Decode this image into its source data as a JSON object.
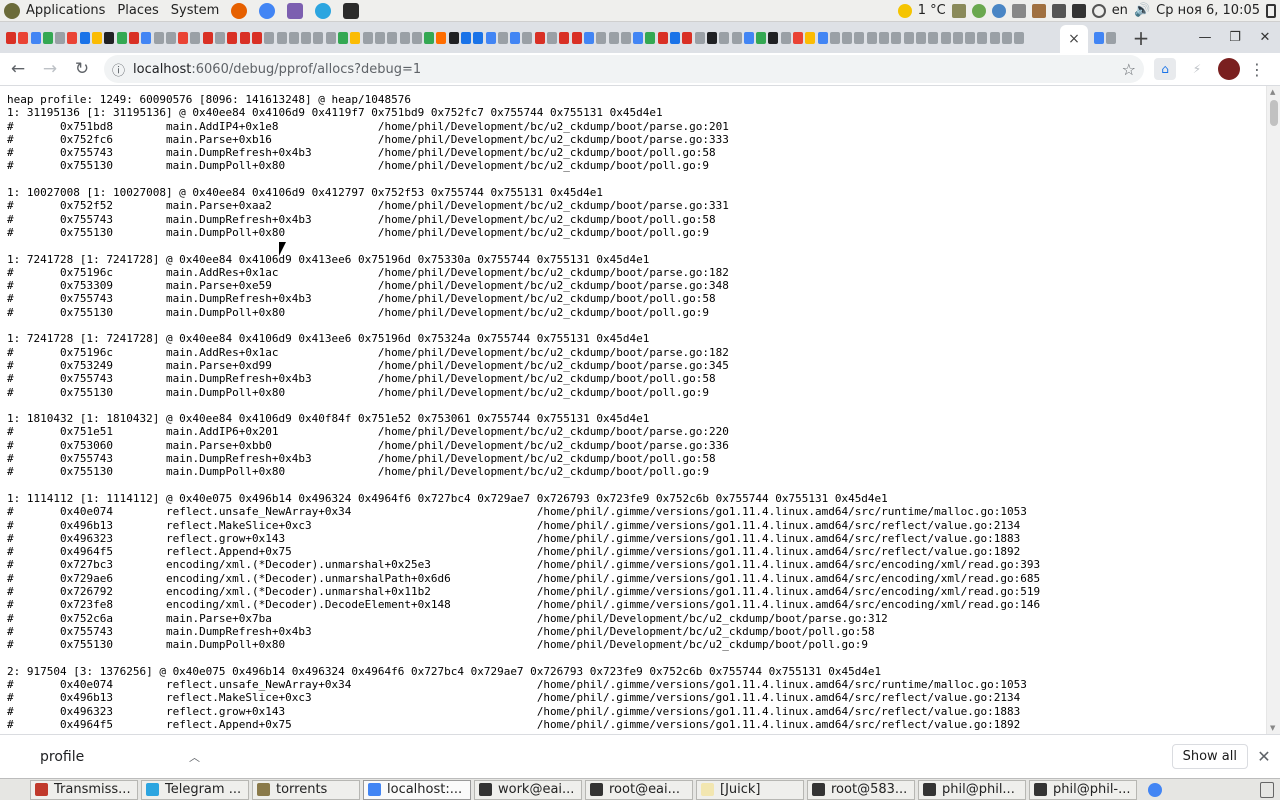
{
  "topbar": {
    "menu": [
      "Applications",
      "Places",
      "System"
    ],
    "weather": "1 °C",
    "lang": "en",
    "clock": "Ср ноя  6, 10:05"
  },
  "tabs": {
    "active_close": "×",
    "new_tab": "+"
  },
  "toolbar": {
    "url_host": "localhost",
    "url_path": ":6060/debug/pprof/allocs?debug=1"
  },
  "profile_text": "heap profile: 1249: 60090576 [8096: 141613248] @ heap/1048576\n1: 31195136 [1: 31195136] @ 0x40ee84 0x4106d9 0x4119f7 0x751bd9 0x752fc7 0x755744 0x755131 0x45d4e1\n#\t0x751bd8\tmain.AddIP4+0x1e8\t\t/home/phil/Development/bc/u2_ckdump/boot/parse.go:201\n#\t0x752fc6\tmain.Parse+0xb16\t\t/home/phil/Development/bc/u2_ckdump/boot/parse.go:333\n#\t0x755743\tmain.DumpRefresh+0x4b3\t\t/home/phil/Development/bc/u2_ckdump/boot/poll.go:58\n#\t0x755130\tmain.DumpPoll+0x80\t\t/home/phil/Development/bc/u2_ckdump/boot/poll.go:9\n\n1: 10027008 [1: 10027008] @ 0x40ee84 0x4106d9 0x412797 0x752f53 0x755744 0x755131 0x45d4e1\n#\t0x752f52\tmain.Parse+0xaa2\t\t/home/phil/Development/bc/u2_ckdump/boot/parse.go:331\n#\t0x755743\tmain.DumpRefresh+0x4b3\t\t/home/phil/Development/bc/u2_ckdump/boot/poll.go:58\n#\t0x755130\tmain.DumpPoll+0x80\t\t/home/phil/Development/bc/u2_ckdump/boot/poll.go:9\n\n1: 7241728 [1: 7241728] @ 0x40ee84 0x4106d9 0x413ee6 0x75196d 0x75330a 0x755744 0x755131 0x45d4e1\n#\t0x75196c\tmain.AddRes+0x1ac\t\t/home/phil/Development/bc/u2_ckdump/boot/parse.go:182\n#\t0x753309\tmain.Parse+0xe59\t\t/home/phil/Development/bc/u2_ckdump/boot/parse.go:348\n#\t0x755743\tmain.DumpRefresh+0x4b3\t\t/home/phil/Development/bc/u2_ckdump/boot/poll.go:58\n#\t0x755130\tmain.DumpPoll+0x80\t\t/home/phil/Development/bc/u2_ckdump/boot/poll.go:9\n\n1: 7241728 [1: 7241728] @ 0x40ee84 0x4106d9 0x413ee6 0x75196d 0x75324a 0x755744 0x755131 0x45d4e1\n#\t0x75196c\tmain.AddRes+0x1ac\t\t/home/phil/Development/bc/u2_ckdump/boot/parse.go:182\n#\t0x753249\tmain.Parse+0xd99\t\t/home/phil/Development/bc/u2_ckdump/boot/parse.go:345\n#\t0x755743\tmain.DumpRefresh+0x4b3\t\t/home/phil/Development/bc/u2_ckdump/boot/poll.go:58\n#\t0x755130\tmain.DumpPoll+0x80\t\t/home/phil/Development/bc/u2_ckdump/boot/poll.go:9\n\n1: 1810432 [1: 1810432] @ 0x40ee84 0x4106d9 0x40f84f 0x751e52 0x753061 0x755744 0x755131 0x45d4e1\n#\t0x751e51\tmain.AddIP6+0x201\t\t/home/phil/Development/bc/u2_ckdump/boot/parse.go:220\n#\t0x753060\tmain.Parse+0xbb0\t\t/home/phil/Development/bc/u2_ckdump/boot/parse.go:336\n#\t0x755743\tmain.DumpRefresh+0x4b3\t\t/home/phil/Development/bc/u2_ckdump/boot/poll.go:58\n#\t0x755130\tmain.DumpPoll+0x80\t\t/home/phil/Development/bc/u2_ckdump/boot/poll.go:9\n\n1: 1114112 [1: 1114112] @ 0x40e075 0x496b14 0x496324 0x4964f6 0x727bc4 0x729ae7 0x726793 0x723fe9 0x752c6b 0x755744 0x755131 0x45d4e1\n#\t0x40e074\treflect.unsafe_NewArray+0x34\t\t\t\t/home/phil/.gimme/versions/go1.11.4.linux.amd64/src/runtime/malloc.go:1053\n#\t0x496b13\treflect.MakeSlice+0xc3\t\t\t\t\t/home/phil/.gimme/versions/go1.11.4.linux.amd64/src/reflect/value.go:2134\n#\t0x496323\treflect.grow+0x143\t\t\t\t\t/home/phil/.gimme/versions/go1.11.4.linux.amd64/src/reflect/value.go:1883\n#\t0x4964f5\treflect.Append+0x75\t\t\t\t\t/home/phil/.gimme/versions/go1.11.4.linux.amd64/src/reflect/value.go:1892\n#\t0x727bc3\tencoding/xml.(*Decoder).unmarshal+0x25e3\t\t/home/phil/.gimme/versions/go1.11.4.linux.amd64/src/encoding/xml/read.go:393\n#\t0x729ae6\tencoding/xml.(*Decoder).unmarshalPath+0x6d6\t\t/home/phil/.gimme/versions/go1.11.4.linux.amd64/src/encoding/xml/read.go:685\n#\t0x726792\tencoding/xml.(*Decoder).unmarshal+0x11b2\t\t/home/phil/.gimme/versions/go1.11.4.linux.amd64/src/encoding/xml/read.go:519\n#\t0x723fe8\tencoding/xml.(*Decoder).DecodeElement+0x148\t\t/home/phil/.gimme/versions/go1.11.4.linux.amd64/src/encoding/xml/read.go:146\n#\t0x752c6a\tmain.Parse+0x7ba\t\t\t\t\t/home/phil/Development/bc/u2_ckdump/boot/parse.go:312\n#\t0x755743\tmain.DumpRefresh+0x4b3\t\t\t\t\t/home/phil/Development/bc/u2_ckdump/boot/poll.go:58\n#\t0x755130\tmain.DumpPoll+0x80\t\t\t\t\t/home/phil/Development/bc/u2_ckdump/boot/poll.go:9\n\n2: 917504 [3: 1376256] @ 0x40e075 0x496b14 0x496324 0x4964f6 0x727bc4 0x729ae7 0x726793 0x723fe9 0x752c6b 0x755744 0x755131 0x45d4e1\n#\t0x40e074\treflect.unsafe_NewArray+0x34\t\t\t\t/home/phil/.gimme/versions/go1.11.4.linux.amd64/src/runtime/malloc.go:1053\n#\t0x496b13\treflect.MakeSlice+0xc3\t\t\t\t\t/home/phil/.gimme/versions/go1.11.4.linux.amd64/src/reflect/value.go:2134\n#\t0x496323\treflect.grow+0x143\t\t\t\t\t/home/phil/.gimme/versions/go1.11.4.linux.amd64/src/reflect/value.go:1883\n#\t0x4964f5\treflect.Append+0x75\t\t\t\t\t/home/phil/.gimme/versions/go1.11.4.linux.amd64/src/reflect/value.go:1892",
  "downloads": {
    "item": "profile",
    "show_all": "Show all"
  },
  "taskbar": [
    {
      "label": "Transmiss..."
    },
    {
      "label": "Telegram ..."
    },
    {
      "label": "torrents"
    },
    {
      "label": "localhost:..."
    },
    {
      "label": "work@eai..."
    },
    {
      "label": "root@eai..."
    },
    {
      "label": "[Juick]"
    },
    {
      "label": "root@583..."
    },
    {
      "label": "phil@phil..."
    },
    {
      "label": "phil@phil-..."
    }
  ]
}
